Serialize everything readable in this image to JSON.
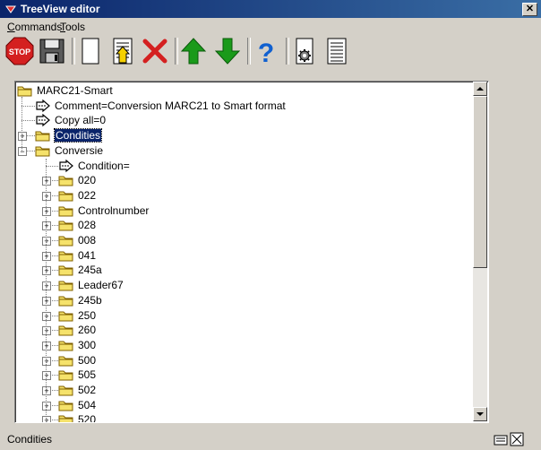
{
  "window": {
    "title": "TreeView editor"
  },
  "menu": [
    {
      "label": "Commands"
    },
    {
      "label": "Tools"
    }
  ],
  "toolbar": [
    {
      "name": "stop-icon",
      "label": "STOP"
    },
    {
      "name": "save-icon"
    },
    {
      "name": "new-icon"
    },
    {
      "name": "edit-icon"
    },
    {
      "name": "delete-icon"
    },
    {
      "name": "move-up-icon"
    },
    {
      "name": "move-down-icon"
    },
    {
      "name": "help-icon"
    },
    {
      "name": "settings-icon"
    },
    {
      "name": "list-icon"
    }
  ],
  "tree": [
    {
      "label": "MARC21-Smart",
      "type": "folder",
      "level": 0,
      "expander": ""
    },
    {
      "label": "Comment=Conversion MARC21 to Smart format",
      "type": "item",
      "level": 1,
      "expander": ""
    },
    {
      "label": "Copy all=0",
      "type": "item",
      "level": 1,
      "expander": ""
    },
    {
      "label": "Condities",
      "type": "folder",
      "level": 1,
      "expander": "+",
      "selected": true
    },
    {
      "label": "Conversie",
      "type": "folder",
      "level": 1,
      "expander": "-"
    },
    {
      "label": "Condition=",
      "type": "item",
      "level": 2,
      "expander": ""
    },
    {
      "label": "020",
      "type": "folder",
      "level": 2,
      "expander": "+"
    },
    {
      "label": "022",
      "type": "folder",
      "level": 2,
      "expander": "+"
    },
    {
      "label": "Controlnumber",
      "type": "folder",
      "level": 2,
      "expander": "+"
    },
    {
      "label": "028",
      "type": "folder",
      "level": 2,
      "expander": "+"
    },
    {
      "label": "008",
      "type": "folder",
      "level": 2,
      "expander": "+"
    },
    {
      "label": "041",
      "type": "folder",
      "level": 2,
      "expander": "+"
    },
    {
      "label": "245a",
      "type": "folder",
      "level": 2,
      "expander": "+"
    },
    {
      "label": "Leader67",
      "type": "folder",
      "level": 2,
      "expander": "+"
    },
    {
      "label": "245b",
      "type": "folder",
      "level": 2,
      "expander": "+"
    },
    {
      "label": "250",
      "type": "folder",
      "level": 2,
      "expander": "+"
    },
    {
      "label": "260",
      "type": "folder",
      "level": 2,
      "expander": "+"
    },
    {
      "label": "300",
      "type": "folder",
      "level": 2,
      "expander": "+"
    },
    {
      "label": "500",
      "type": "folder",
      "level": 2,
      "expander": "+"
    },
    {
      "label": "505",
      "type": "folder",
      "level": 2,
      "expander": "+"
    },
    {
      "label": "502",
      "type": "folder",
      "level": 2,
      "expander": "+"
    },
    {
      "label": "504",
      "type": "folder",
      "level": 2,
      "expander": "+"
    },
    {
      "label": "520",
      "type": "folder",
      "level": 2,
      "expander": "+"
    }
  ],
  "status": {
    "text": "Condities"
  },
  "colors": {
    "titlebar": "#0a246a",
    "selection": "#0a246a",
    "folder": "#f5e26b",
    "stop": "#d42020",
    "arrow": "#1a9a1a",
    "help": "#1060d0"
  }
}
